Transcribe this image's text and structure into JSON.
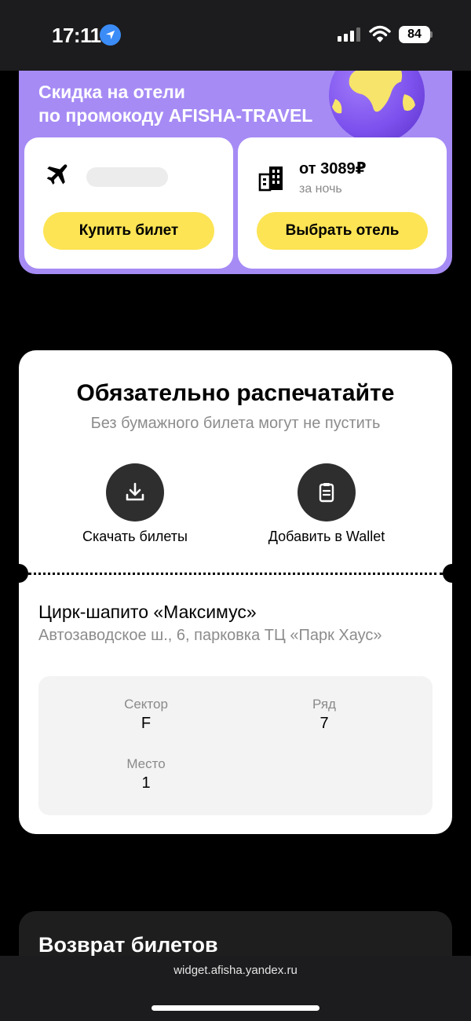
{
  "status_bar": {
    "time": "17:11",
    "battery": "84"
  },
  "promo": {
    "title_line1": "Скидка на отели",
    "title_line2": "по промокоду AFISHA-TRAVEL",
    "flight": {
      "button_label": "Купить билет"
    },
    "hotel": {
      "price": "от 3089₽",
      "per_night": "за ночь",
      "button_label": "Выбрать отель"
    }
  },
  "ticket": {
    "title": "Обязательно распечатайте",
    "subtitle": "Без бумажного билета могут не пустить",
    "download_label": "Скачать билеты",
    "wallet_label": "Добавить в Wallet",
    "venue": "Цирк-шапито «Максимус»",
    "address": "Автозаводское ш., 6, парковка ТЦ «Парк Хаус»",
    "seat": {
      "sector_label": "Сектор",
      "sector_value": "F",
      "row_label": "Ряд",
      "row_value": "7",
      "place_label": "Место",
      "place_value": "1"
    }
  },
  "return_section": {
    "title": "Возврат билетов"
  },
  "browser": {
    "url": "widget.afisha.yandex.ru"
  },
  "colors": {
    "promo_bg": "#a68bf5",
    "button_yellow": "#fce454",
    "location_blue": "#3b8cf7"
  }
}
